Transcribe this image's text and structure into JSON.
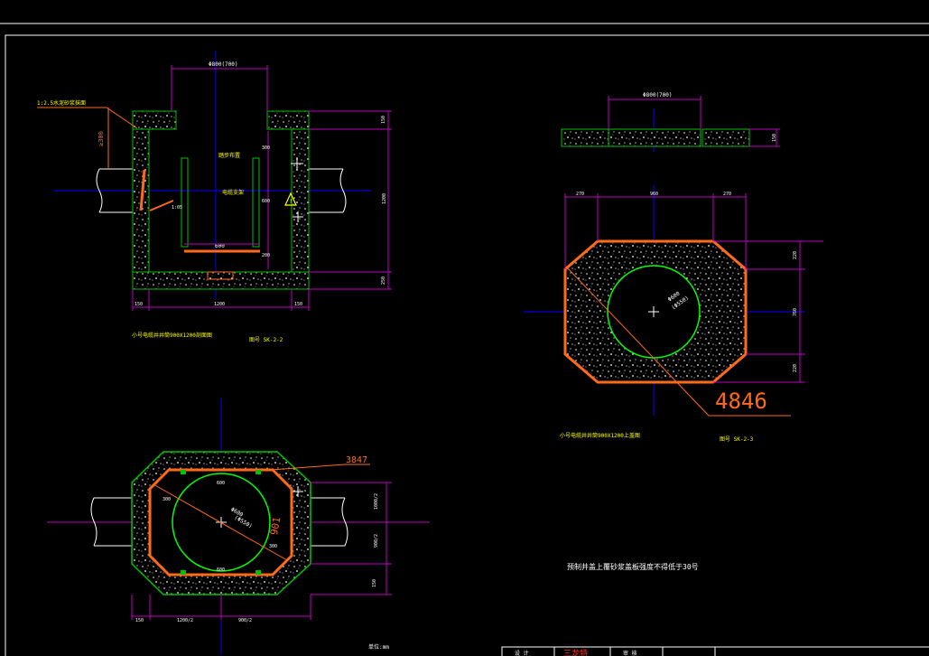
{
  "colors": {
    "background": "#000000",
    "frame": "#ffffff",
    "concrete": "#00c000",
    "centerline": "#0000ff",
    "dimension": "#c000c0",
    "annotation": "#ffff00",
    "highlight": "#ff6a1a",
    "ring": "#00ff00"
  },
  "section_view": {
    "dim_top_opening": "Φ800(700)",
    "note_mortar": "1:2.5水泥砂浆抹面",
    "dim_left_vertical": "≥300",
    "label_inner_top": "踏步布置",
    "label_inner_pipe": "电缆支架",
    "dim_inner_width": "600",
    "dim_slope": "1:05",
    "dim_r_300": "300",
    "dim_r_600": "600",
    "dim_r_200": "200",
    "dim_top_thk": "150",
    "dim_total_h": "1200",
    "dim_base_thk": "250",
    "dim_bottom_left": "150",
    "dim_bottom_mid": "1200",
    "dim_bottom_right": "150",
    "title": "小号电缆井井筒900X1200剖面图",
    "drawing_no": "图号 SK-2-2"
  },
  "cover_slab": {
    "dim_top": "Φ800(700)",
    "dim_right": "150"
  },
  "top_plan": {
    "dim_left": "270",
    "dim_mid": "960",
    "dim_right": "270",
    "dim_r1": "220",
    "dim_r2": "760",
    "dim_r3": "220",
    "circle_label_1": "Φ600",
    "circle_label_2": "(Φ550)",
    "big_annotation": "4846",
    "title": "小号电缆井井筒900X1200上盖图",
    "drawing_no": "图号 SK-2-3"
  },
  "bottom_plan": {
    "annotation_3847": "3847",
    "dim_top_600": "600",
    "dim_left_300": "300",
    "dim_bottom_600": "600",
    "dim_right_300": "300",
    "circle_label_1": "Φ600",
    "circle_label_2": "(Φ550)",
    "annotation_901": "901",
    "dim_right_upper": "1000/2",
    "dim_right_lower": "900/2",
    "dim_right_base": "150",
    "dim_bottom_left": "150",
    "dim_bottom_mid": "1200/2",
    "dim_bottom_right": "900/2",
    "unit_note": "单位:mm"
  },
  "notes": {
    "main_note": "预制井盖上覆砂浆盖板强度不得低于30号"
  },
  "title_block": {
    "cell_1": "设 计",
    "signature": "三龙特",
    "cell_3": "审 核"
  }
}
